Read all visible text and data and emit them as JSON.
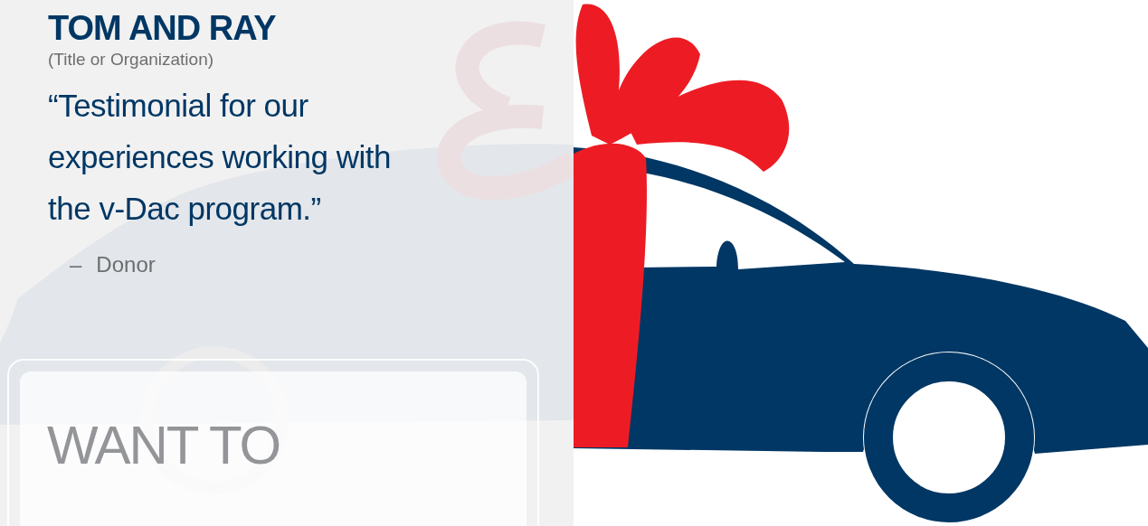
{
  "testimonial": {
    "name": "TOM AND RAY",
    "subtitle": "(Title or Organization)",
    "quote_lines": [
      "“Testimonial for our",
      "experiences working with",
      "the v-Dac program.”"
    ],
    "dash": "–",
    "author": "Donor"
  },
  "cta": {
    "heading": "WANT TO"
  }
}
